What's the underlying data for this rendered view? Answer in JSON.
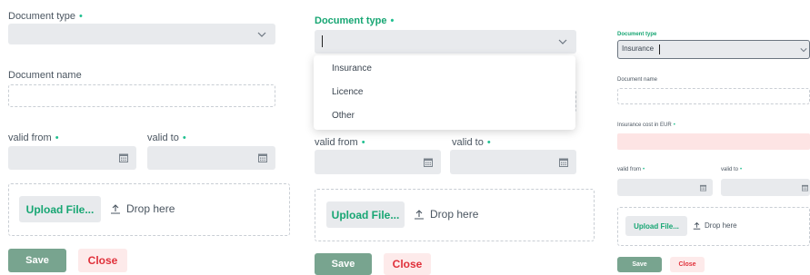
{
  "panel1": {
    "doc_type_label": "Document type",
    "doc_name_label": "Document name",
    "valid_from_label": "valid from",
    "valid_to_label": "valid to",
    "required_mark": "•",
    "upload_label": "Upload File...",
    "drop_label": "Drop here",
    "save_label": "Save",
    "close_label": "Close"
  },
  "panel2": {
    "doc_type_label": "Document type",
    "required_mark": "•",
    "dropdown_options": [
      "Insurance",
      "Licence",
      "Other"
    ],
    "valid_from_label": "valid from",
    "valid_to_label": "valid to",
    "upload_label": "Upload File...",
    "drop_label": "Drop here",
    "save_label": "Save",
    "close_label": "Close"
  },
  "panel3": {
    "doc_type_label": "Document type",
    "doc_type_value": "Insurance",
    "doc_name_label": "Document name",
    "insurance_cost_label": "Insurance cost in EUR",
    "valid_from_label": "valid from",
    "valid_to_label": "valid to",
    "required_mark": "•",
    "upload_label": "Upload File...",
    "drop_label": "Drop here",
    "save_label": "Save",
    "close_label": "Close"
  },
  "colors": {
    "accent": "#17a673",
    "required": "#1fbf8f",
    "field_bg": "#e8eaed",
    "error_bg": "#fde4e4",
    "save_bg": "#78a48f",
    "close_text": "#e0303a"
  }
}
